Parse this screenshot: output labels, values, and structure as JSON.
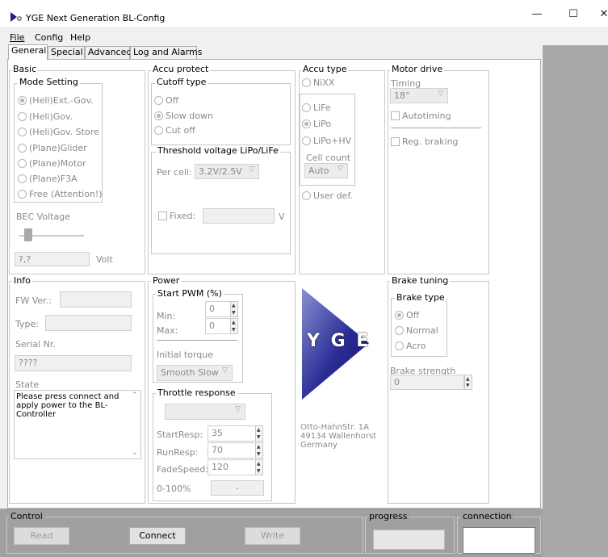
{
  "window": {
    "title": "YGE Next Generation BL-Config",
    "controls": {
      "minimize": "—",
      "maximize": "☐",
      "close": "✕"
    }
  },
  "menu": [
    {
      "label": "File"
    },
    {
      "label": "Config"
    },
    {
      "label": "Help"
    }
  ],
  "tabs": [
    {
      "label": "General",
      "active": true
    },
    {
      "label": "Special"
    },
    {
      "label": "Advanced"
    },
    {
      "label": "Log and Alarms"
    }
  ],
  "basic": {
    "title": "Basic",
    "mode_group": "Mode Setting",
    "modes": [
      "(Heli)Ext.-Gov.",
      "(Heli)Gov.",
      "(Heli)Gov. Store",
      "(Plane)Glider",
      "(Plane)Motor",
      "(Plane)F3A",
      "Free (Attention!)"
    ],
    "selected_mode": 0,
    "bec_label": "BEC Voltage",
    "bec_slider_level": 0.1,
    "bec_value": "?,?",
    "bec_unit": "Volt"
  },
  "accu_protect": {
    "title": "Accu protect",
    "cutoff_group": "Cutoff type",
    "cutoff_options": [
      "Off",
      "Slow down",
      "Cut off"
    ],
    "selected_cutoff": 1,
    "threshold_group": "Threshold voltage LiPo/LiFe",
    "per_cell_label": "Per cell:",
    "per_cell_value": "3.2V/2.5V",
    "fixed_label": "Fixed:",
    "fixed_value": "",
    "fixed_unit": "V"
  },
  "accu_type": {
    "title": "Accu type",
    "nixx": "NiXX",
    "options": [
      "LiFe",
      "LiPo",
      "LiPo+HV"
    ],
    "selected": 1,
    "cell_count_label": "Cell count",
    "cell_count_value": "Auto",
    "user_def": "User def."
  },
  "motor_drive": {
    "title": "Motor drive",
    "timing_label": "Timing",
    "timing_value": "18°",
    "autotiming": "Autotiming",
    "reg_braking": "Reg. braking"
  },
  "info": {
    "title": "Info",
    "fw_label": "FW Ver.:",
    "fw_value": "",
    "type_label": "Type:",
    "type_value": "",
    "serial_label": "Serial Nr.",
    "serial_value": "????",
    "state_label": "State",
    "state_text": "Please press connect and apply power to the BL-Controller"
  },
  "power": {
    "title": "Power",
    "pwm_group": "Start PWM (%)",
    "min_label": "Min:",
    "min_value": "0",
    "max_label": "Max:",
    "max_value": "0",
    "initial_torque_label": "Initial torque",
    "initial_torque_value": "Smooth Slow",
    "throttle_group": "Throttle response",
    "throttle_combo_value": "",
    "start_resp_label": "StartResp:",
    "start_resp_value": "35",
    "run_resp_label": "RunResp:",
    "run_resp_value": "70",
    "fade_speed_label": "FadeSpeed:",
    "fade_speed_value": "120",
    "range_label": "0-100%",
    "range_value": "-"
  },
  "company": {
    "logo_text": "Y G E",
    "address_lines": [
      "Otto-HahnStr. 1A",
      "49134 Wallenhorst",
      "Germany"
    ]
  },
  "brake_tuning": {
    "title": "Brake tuning",
    "type_group": "Brake type",
    "options": [
      "Off",
      "Normal",
      "Acro"
    ],
    "selected": 0,
    "strength_label": "Brake strength",
    "strength_value": "0"
  },
  "control": {
    "title": "Control",
    "read_label": "Read",
    "connect_label": "Connect",
    "write_label": "Write",
    "progress_label": "progress",
    "progress_value": 0,
    "connection_label": "connection"
  },
  "colors": {
    "logo_blue": "#1d1f8c",
    "logo_light": "#7f86c8"
  }
}
